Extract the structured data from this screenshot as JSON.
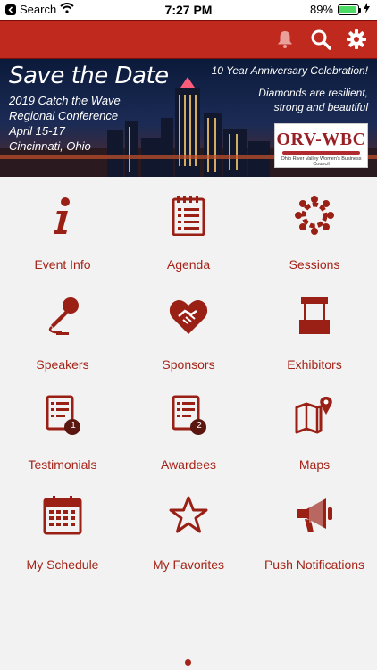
{
  "status_bar": {
    "back_label": "Search",
    "time": "7:27 PM",
    "battery": "89%",
    "battery_level": 0.89
  },
  "banner": {
    "headline": "Save the Date",
    "event_line1": "2019 Catch the Wave",
    "event_line2": "Regional Conference",
    "event_dates": "April 15-17",
    "event_city": "Cincinnati, Ohio",
    "anniversary": "10 Year Anniversary Celebration!",
    "tagline1": "Diamonds are resilient,",
    "tagline2": "strong and beautiful",
    "logo_text": "ORV-WBC",
    "logo_sub": "Ohio River Valley Women's Business Council"
  },
  "menu": {
    "event_info": "Event Info",
    "agenda": "Agenda",
    "sessions": "Sessions",
    "speakers": "Speakers",
    "sponsors": "Sponsors",
    "exhibitors": "Exhibitors",
    "testimonials": "Testimonials",
    "testimonials_badge": "1",
    "awardees": "Awardees",
    "awardees_badge": "2",
    "maps": "Maps",
    "my_schedule": "My Schedule",
    "my_favorites": "My Favorites",
    "push_notifications": "Push Notifications"
  },
  "colors": {
    "accent": "#a52418",
    "header": "#c0291e"
  }
}
